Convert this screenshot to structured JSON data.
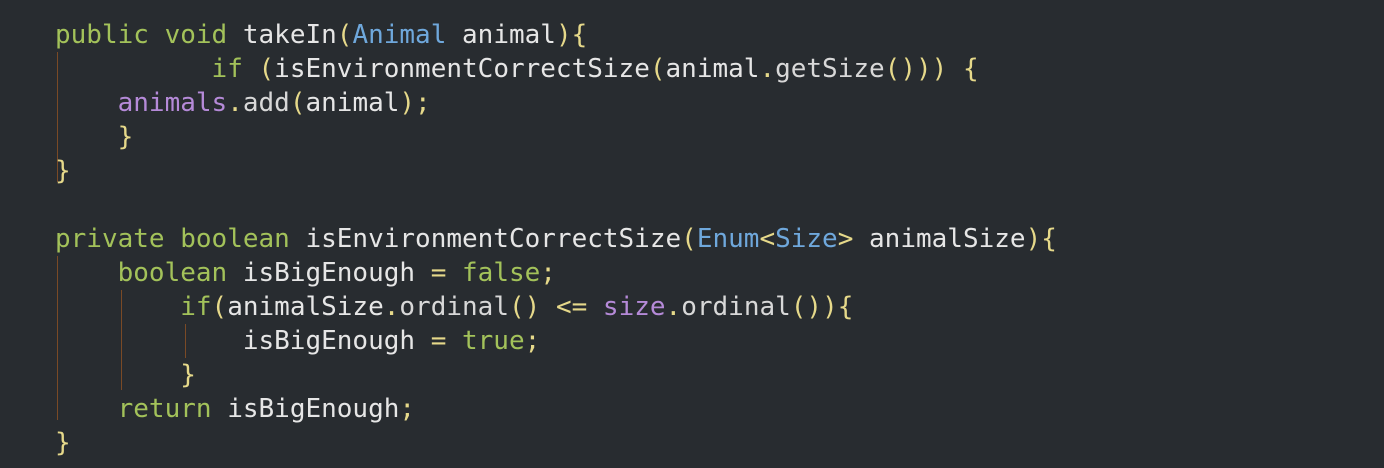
{
  "colors": {
    "background": "#282c30",
    "keyword": "#a3c25a",
    "type": "#6fa8dc",
    "field": "#b58ad8",
    "punctuation": "#e6d98a",
    "identifier": "#e6e6e6",
    "indent_guide": "#7a4a26"
  },
  "code": {
    "lines": [
      [
        {
          "k": "kw",
          "t": "public"
        },
        {
          "k": "ident",
          "t": " "
        },
        {
          "k": "kw",
          "t": "void"
        },
        {
          "k": "ident",
          "t": " takeIn"
        },
        {
          "k": "punct",
          "t": "("
        },
        {
          "k": "type",
          "t": "Animal"
        },
        {
          "k": "ident",
          "t": " animal"
        },
        {
          "k": "punct",
          "t": "){"
        }
      ],
      [
        {
          "k": "ident",
          "t": "          "
        },
        {
          "k": "kw",
          "t": "if"
        },
        {
          "k": "ident",
          "t": " "
        },
        {
          "k": "punct",
          "t": "("
        },
        {
          "k": "ident",
          "t": "isEnvironmentCorrectSize"
        },
        {
          "k": "punct",
          "t": "("
        },
        {
          "k": "ident",
          "t": "animal"
        },
        {
          "k": "punct",
          "t": "."
        },
        {
          "k": "call",
          "t": "getSize"
        },
        {
          "k": "punct",
          "t": "()))"
        },
        {
          "k": "ident",
          "t": " "
        },
        {
          "k": "punct",
          "t": "{"
        }
      ],
      [
        {
          "k": "ident",
          "t": "    "
        },
        {
          "k": "field",
          "t": "animals"
        },
        {
          "k": "punct",
          "t": "."
        },
        {
          "k": "call",
          "t": "add"
        },
        {
          "k": "punct",
          "t": "("
        },
        {
          "k": "ident",
          "t": "animal"
        },
        {
          "k": "punct",
          "t": ");"
        }
      ],
      [
        {
          "k": "ident",
          "t": "    "
        },
        {
          "k": "punct",
          "t": "}"
        }
      ],
      [
        {
          "k": "punct",
          "t": "}"
        }
      ],
      [],
      [
        {
          "k": "kw",
          "t": "private"
        },
        {
          "k": "ident",
          "t": " "
        },
        {
          "k": "kw",
          "t": "boolean"
        },
        {
          "k": "ident",
          "t": " isEnvironmentCorrectSize"
        },
        {
          "k": "punct",
          "t": "("
        },
        {
          "k": "type",
          "t": "Enum"
        },
        {
          "k": "punct",
          "t": "<"
        },
        {
          "k": "type",
          "t": "Size"
        },
        {
          "k": "punct",
          "t": ">"
        },
        {
          "k": "ident",
          "t": " animalSize"
        },
        {
          "k": "punct",
          "t": "){"
        }
      ],
      [
        {
          "k": "ident",
          "t": "    "
        },
        {
          "k": "kw",
          "t": "boolean"
        },
        {
          "k": "ident",
          "t": " isBigEnough "
        },
        {
          "k": "punct",
          "t": "="
        },
        {
          "k": "ident",
          "t": " "
        },
        {
          "k": "kw",
          "t": "false"
        },
        {
          "k": "punct",
          "t": ";"
        }
      ],
      [
        {
          "k": "ident",
          "t": "        "
        },
        {
          "k": "kw",
          "t": "if"
        },
        {
          "k": "punct",
          "t": "("
        },
        {
          "k": "ident",
          "t": "animalSize"
        },
        {
          "k": "punct",
          "t": "."
        },
        {
          "k": "call",
          "t": "ordinal"
        },
        {
          "k": "punct",
          "t": "()"
        },
        {
          "k": "ident",
          "t": " "
        },
        {
          "k": "punct",
          "t": "<="
        },
        {
          "k": "ident",
          "t": " "
        },
        {
          "k": "field",
          "t": "size"
        },
        {
          "k": "punct",
          "t": "."
        },
        {
          "k": "call",
          "t": "ordinal"
        },
        {
          "k": "punct",
          "t": "()){"
        }
      ],
      [
        {
          "k": "ident",
          "t": "            isBigEnough "
        },
        {
          "k": "punct",
          "t": "="
        },
        {
          "k": "ident",
          "t": " "
        },
        {
          "k": "kw",
          "t": "true"
        },
        {
          "k": "punct",
          "t": ";"
        }
      ],
      [
        {
          "k": "ident",
          "t": "        "
        },
        {
          "k": "punct",
          "t": "}"
        }
      ],
      [
        {
          "k": "ident",
          "t": "    "
        },
        {
          "k": "kw",
          "t": "return"
        },
        {
          "k": "ident",
          "t": " isBigEnough"
        },
        {
          "k": "punct",
          "t": ";"
        }
      ],
      [
        {
          "k": "punct",
          "t": "}"
        }
      ]
    ]
  }
}
